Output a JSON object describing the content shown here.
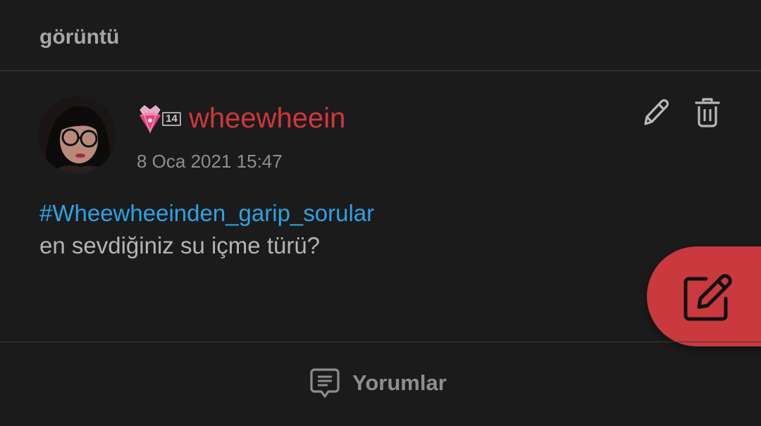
{
  "header": {
    "title": "görüntü"
  },
  "post": {
    "author": {
      "username": "wheewheein",
      "level": "14",
      "username_color": "#d0383a"
    },
    "timestamp": "8 Oca 2021 15:47",
    "hashtag": "#Wheewheeinden_garip_sorular",
    "text": "en sevdiğiniz su içme türü?",
    "actions": {
      "edit_icon": "pencil-icon",
      "delete_icon": "trash-icon"
    }
  },
  "fab": {
    "icon": "compose-icon",
    "color": "#c9393d"
  },
  "footer": {
    "comments_label": "Yorumlar",
    "comments_icon": "comment-icon"
  },
  "colors": {
    "background": "#1b1b1c",
    "hashtag": "#2fa2e2",
    "accent": "#c9393d"
  }
}
